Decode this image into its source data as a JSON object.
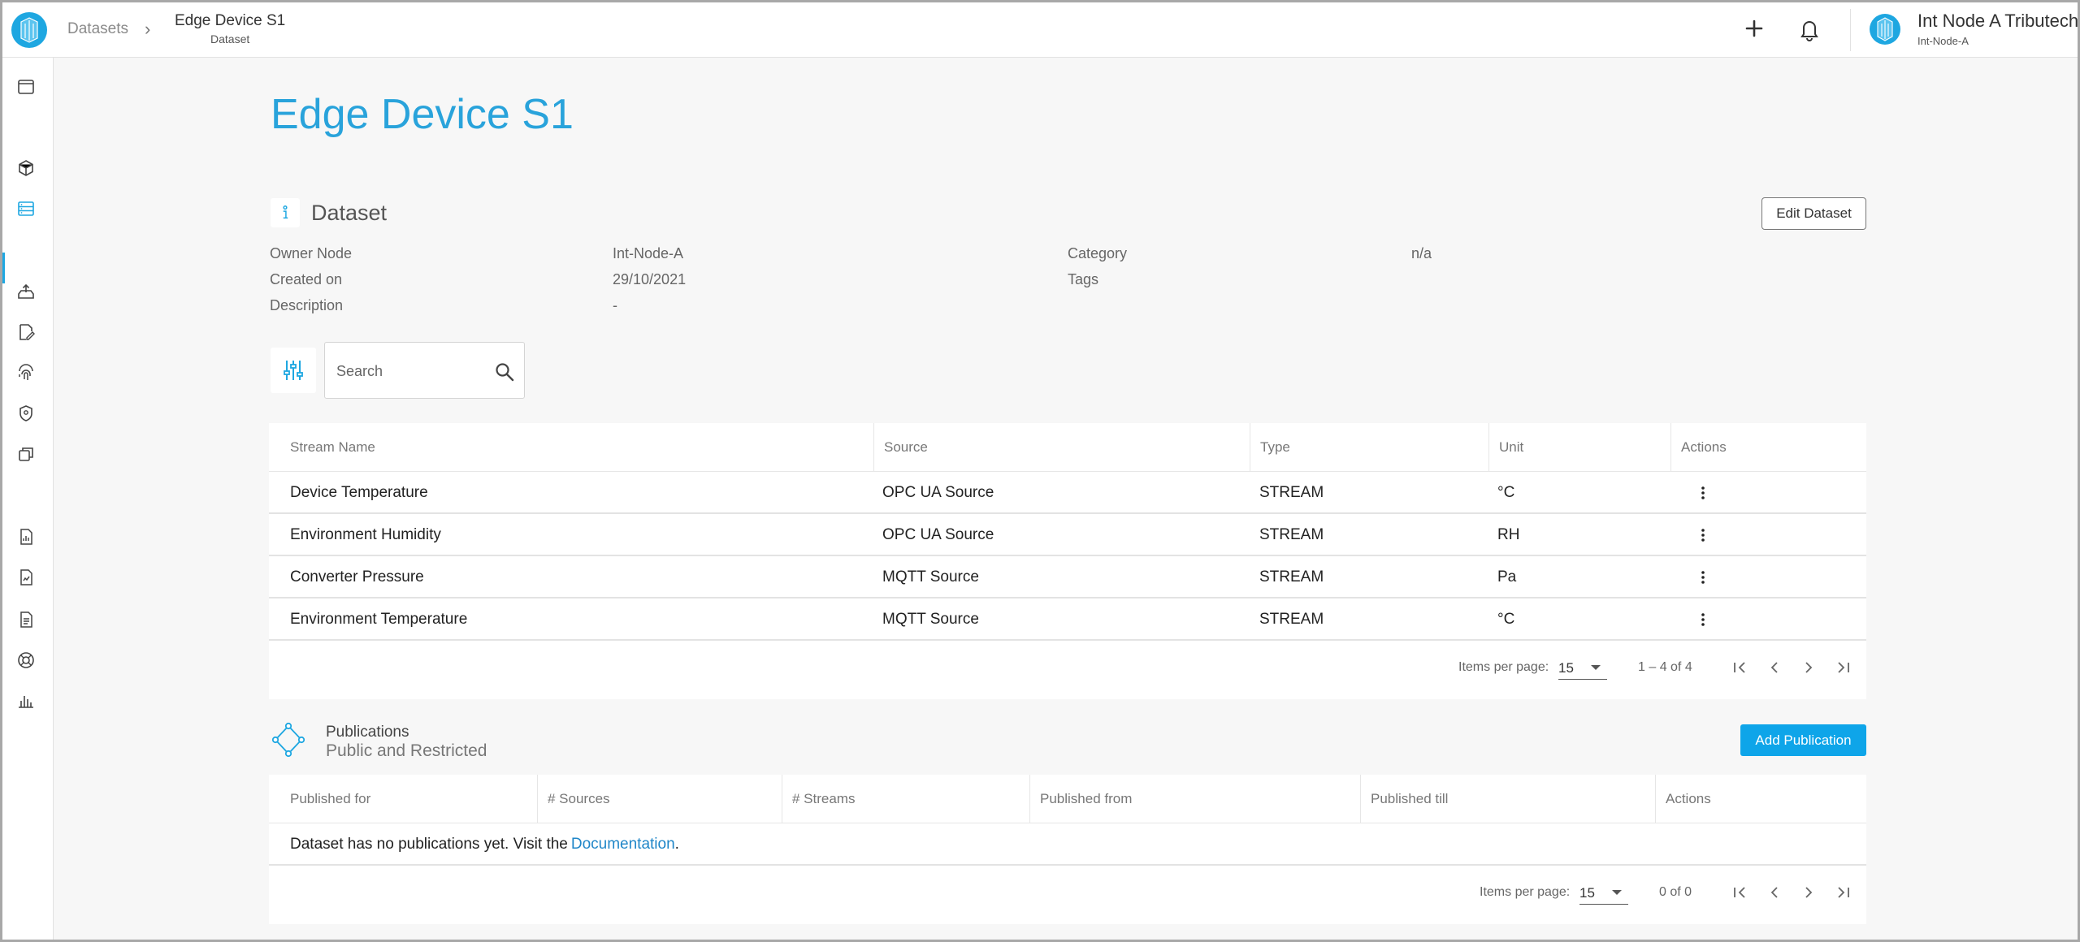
{
  "header": {
    "breadcrumb_root": "Datasets",
    "breadcrumb_current": "Edge Device S1",
    "breadcrumb_current_sub": "Dataset",
    "user_name": "Int Node A Tributech",
    "user_node": "Int-Node-A"
  },
  "page": {
    "title": "Edge Device S1",
    "section_title": "Dataset",
    "edit_button": "Edit Dataset"
  },
  "details": {
    "owner_node_label": "Owner Node",
    "owner_node_value": "Int-Node-A",
    "created_on_label": "Created on",
    "created_on_value": "29/10/2021",
    "description_label": "Description",
    "description_value": "-",
    "category_label": "Category",
    "category_value": "n/a",
    "tags_label": "Tags"
  },
  "search": {
    "placeholder": "Search"
  },
  "streams": {
    "columns": [
      "Stream Name",
      "Source",
      "Type",
      "Unit",
      "Actions"
    ],
    "rows": [
      {
        "name": "Device Temperature",
        "source": "OPC UA Source",
        "type": "STREAM",
        "unit": "°C"
      },
      {
        "name": "Environment Humidity",
        "source": "OPC UA Source",
        "type": "STREAM",
        "unit": "RH"
      },
      {
        "name": "Converter Pressure",
        "source": "MQTT Source",
        "type": "STREAM",
        "unit": "Pa"
      },
      {
        "name": "Environment Temperature",
        "source": "MQTT Source",
        "type": "STREAM",
        "unit": "°C"
      }
    ],
    "items_per_page_label": "Items per page:",
    "items_per_page": "15",
    "range": "1 – 4 of 4"
  },
  "publications": {
    "title": "Publications",
    "subtitle": "Public and Restricted",
    "add_button": "Add Publication",
    "columns": [
      "Published for",
      "# Sources",
      "# Streams",
      "Published from",
      "Published till",
      "Actions"
    ],
    "empty_text": "Dataset has no publications yet.  Visit the",
    "doc_link": "Documentation",
    "empty_suffix": ".",
    "items_per_page_label": "Items per page:",
    "items_per_page": "15",
    "range": "0 of 0"
  },
  "colors": {
    "accent": "#29a3db",
    "button_primary": "#0ea5e9"
  },
  "icons": {
    "rail": [
      "window-icon",
      "cube-icon",
      "datasets-icon",
      "upload-icon",
      "edit-doc-icon",
      "fingerprint-icon",
      "shield-icon",
      "copy-icon",
      "file-chart-icon",
      "file-chart-2-icon",
      "document-icon",
      "lifebuoy-icon",
      "bar-chart-icon"
    ]
  }
}
